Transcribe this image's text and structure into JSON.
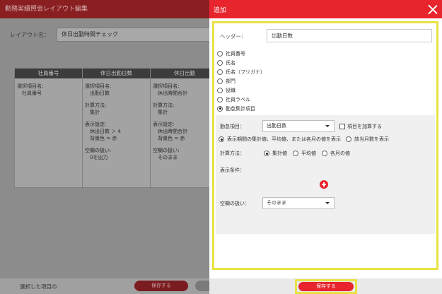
{
  "background": {
    "title": "勤務実績照会レイアウト編集",
    "layout_name_label": "レイアウト名：",
    "layout_name_value": "休日出勤時間チェック",
    "columns": [
      {
        "header": "社員番号",
        "lines": [
          {
            "text": "選択項目名:",
            "indent": false
          },
          {
            "text": "社員番号",
            "indent": true
          }
        ]
      },
      {
        "header": "休日出勤日数",
        "lines": [
          {
            "text": "選択項目名:",
            "indent": false
          },
          {
            "text": "出勤日数",
            "indent": true
          },
          {
            "text": "計算方法:",
            "indent": false
          },
          {
            "text": "集計",
            "indent": true
          },
          {
            "text": "表示設定:",
            "indent": false
          },
          {
            "text": "休出日数 ＞ 4",
            "indent": true
          },
          {
            "text": "背景色 = 赤",
            "indent": true
          },
          {
            "text": "空欄の扱い:",
            "indent": false
          },
          {
            "text": "0を出力",
            "indent": true
          }
        ]
      },
      {
        "header": "休日出勤",
        "lines": [
          {
            "text": "選択項目名:",
            "indent": false
          },
          {
            "text": "休出時間合計",
            "indent": true
          },
          {
            "text": "計算方法:",
            "indent": false
          },
          {
            "text": "集計",
            "indent": true
          },
          {
            "text": "表示設定:",
            "indent": false
          },
          {
            "text": "休出時間合計",
            "indent": true
          },
          {
            "text": "背景色 = 赤",
            "indent": true
          },
          {
            "text": "空欄の扱い:",
            "indent": false
          },
          {
            "text": "そのまま",
            "indent": true
          }
        ]
      }
    ],
    "footer_text": "選択した項目の",
    "footer_save": "保存する"
  },
  "panel": {
    "title": "追加",
    "header_label": "ヘッダー：",
    "header_value": "出勤日数",
    "radio_options": [
      {
        "label": "社員番号",
        "checked": false
      },
      {
        "label": "氏名",
        "checked": false
      },
      {
        "label": "氏名（フリガナ）",
        "checked": false
      },
      {
        "label": "部門",
        "checked": false
      },
      {
        "label": "役職",
        "checked": false
      },
      {
        "label": "社員ラベル",
        "checked": false
      },
      {
        "label": "勤怠集計項目",
        "checked": true
      }
    ],
    "attendance_item_label": "勤怠項目：",
    "attendance_item_value": "出勤日数",
    "add_item_checkbox_label": "項目を加算する",
    "display_period_option": "表示期間の集計値、平均値、または各月の値を表示",
    "month_count_option": "該当月数を表示",
    "calc_method_label": "計算方法：",
    "calc_options": [
      "集計値",
      "平均値",
      "各月の値"
    ],
    "display_condition_label": "表示条件：",
    "blank_handling_label": "空欄の扱い：",
    "blank_handling_value": "そのまま",
    "save_label": "保存する"
  },
  "colors": {
    "accent": "#e8242c",
    "highlight": "#e9e244"
  }
}
